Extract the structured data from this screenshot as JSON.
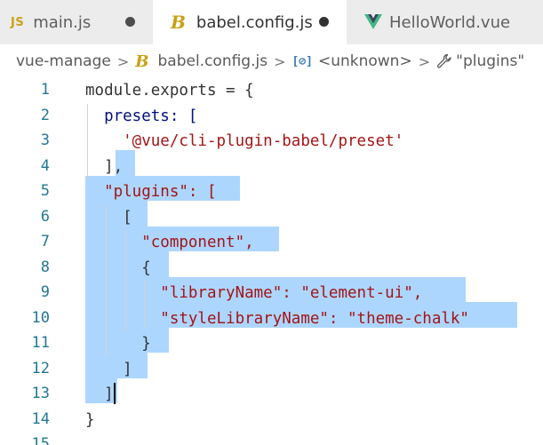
{
  "tabs": [
    {
      "icon": "js-icon",
      "icon_text": "JS",
      "label": "main.js",
      "dirty": true
    },
    {
      "icon": "babel-icon",
      "icon_text": "B",
      "label": "babel.config.js",
      "dirty": true,
      "active": true
    },
    {
      "icon": "vue-icon",
      "label": "HelloWorld.vue",
      "dirty": false
    }
  ],
  "breadcrumb": {
    "items": [
      {
        "label": "vue-manage"
      },
      {
        "icon": "babel-icon",
        "icon_text": "B",
        "label": "babel.config.js"
      },
      {
        "icon": "object-icon",
        "icon_text": "[⊘]",
        "label": "<unknown>"
      },
      {
        "icon": "wrench-icon",
        "label": "\"plugins\""
      }
    ],
    "separator": ">"
  },
  "editor": {
    "line_numbers": [
      "1",
      "2",
      "3",
      "4",
      "5",
      "6",
      "7",
      "8",
      "9",
      "10",
      "11",
      "12",
      "13",
      "14",
      "15"
    ],
    "lines": [
      "module.exports = {",
      "  presets: [",
      "    '@vue/cli-plugin-babel/preset'",
      "  ],",
      "  \"plugins\": [",
      "    [",
      "      \"component\",",
      "      {",
      "        \"libraryName\": \"element-ui\",",
      "        \"styleLibraryName\": \"theme-chalk\"",
      "      }",
      "    ]",
      "  ]",
      "}",
      ""
    ]
  },
  "colors": {
    "tab_bar": "#f3f3f3",
    "active_tab": "#ffffff",
    "selection": "#add6ff",
    "line_number": "#237893",
    "string": "#a31515",
    "identifier": "#001080",
    "icon_yellow": "#c9a117",
    "vue_green": "#41b883"
  }
}
